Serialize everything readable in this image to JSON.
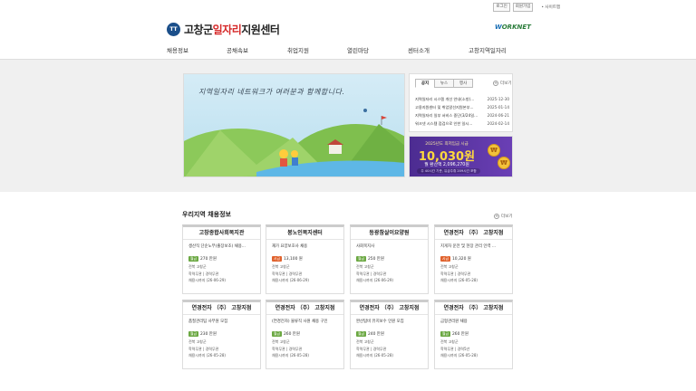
{
  "util": {
    "login": "로그인",
    "join": "회원가입",
    "sitemap": "• 사이트맵"
  },
  "logo": {
    "emblem": "TT",
    "pre": "고창군",
    "highlight": "일자리",
    "post": "지원센터"
  },
  "worknet": {
    "w": "W",
    "rest": "ORKNET"
  },
  "gnb": [
    "채용정보",
    "공채속보",
    "취업지원",
    "열린마당",
    "센터소개",
    "고창지역일자리"
  ],
  "banner": {
    "slogan": "지역일자리 네트워크가 여러분과 함께합니다."
  },
  "notice": {
    "tabs": [
      "공지",
      "뉴스",
      "행사"
    ],
    "more": "더보기",
    "items": [
      {
        "title": "지역일자리 시스템 개선 안내(소방)...",
        "date": "2025-12-30"
      },
      {
        "title": "고용지원센터 및 취업알선지원본부...",
        "date": "2025-01-14"
      },
      {
        "title": "지역일자리 일부 서비스 중단(3/24일...",
        "date": "2024-06-21"
      },
      {
        "title": "워크넷 시스템 점검으로 인한 일시...",
        "date": "2024-02-14"
      }
    ]
  },
  "wage": {
    "year_line": "2025년도 최저임금 시급",
    "amount": "10,030원",
    "monthly": "월 환산액 2,096,270원",
    "note": "주 40시간 기준, 유급주휴 209시간 포함",
    "coin": "₩"
  },
  "section": {
    "title": "우리지역 채용정보",
    "more": "더보기"
  },
  "colors": {
    "badge_month": "#6ba842",
    "badge_year": "#e0622d",
    "badge_hour": "#6ba842"
  },
  "cards": [
    {
      "company": "고창종합사회복지관",
      "job": "생산직 단순노무(출장보조) 채용...",
      "pay_type": "월급",
      "pay_amount": "270 만원",
      "region": "전북 고창군",
      "condition": "학력무관 | 경력무관",
      "deadline": "채용시까지 (26-06-29)"
    },
    {
      "company": "봉노인복지센터",
      "job": "재가 요양보호사 채용",
      "pay_type": "시급",
      "pay_amount": "13,100 원",
      "region": "전북 고창군",
      "condition": "학력무관 | 경력무관",
      "deadline": "채용시까지 (26-06-29)"
    },
    {
      "company": "등광참살이요양원",
      "job": "사회복지사",
      "pay_type": "월급",
      "pay_amount": "250 만원",
      "region": "전북 고창군",
      "condition": "학력무관 | 경력무관",
      "deadline": "채용시까지 (26-06-29)"
    },
    {
      "company": "연경전자 （주） 고창지점",
      "job": "지게차 운전 및 현장 관리 인력 ...",
      "pay_type": "시급",
      "pay_amount": "10,320 원",
      "region": "전북 고창군",
      "condition": "학력무관 | 경력무관",
      "deadline": "채용시까지 (26-05-28)"
    },
    {
      "company": "연경전자 （주） 고창지점",
      "job": "품질관리팀 사무원 모집",
      "pay_type": "월급",
      "pay_amount": "230 만원",
      "region": "전북 고창군",
      "condition": "학력무관 | 경력무관",
      "deadline": "채용시까지 (26-05-28)"
    },
    {
      "company": "연경전자 （주） 고창지점",
      "job": "(연경전자) 물류직 사원 채용 구인",
      "pay_type": "월급",
      "pay_amount": "260 만원",
      "region": "전북 고창군",
      "condition": "학력무관 | 경력무관",
      "deadline": "채용시까지 (26-05-28)"
    },
    {
      "company": "연경전자 （주） 고창지점",
      "job": "완산탑비 유지보수 인원 모집",
      "pay_type": "월급",
      "pay_amount": "240 만원",
      "region": "전북 고창군",
      "condition": "학력무관 | 경력무관",
      "deadline": "채용시까지 (26-05-28)"
    },
    {
      "company": "연경전자 （주） 고창지점",
      "job": "금형관리원 채용",
      "pay_type": "월급",
      "pay_amount": "260 만원",
      "region": "전북 고창군",
      "condition": "학력무관 | 경력5년",
      "deadline": "채용시까지 (26-05-28)"
    }
  ]
}
